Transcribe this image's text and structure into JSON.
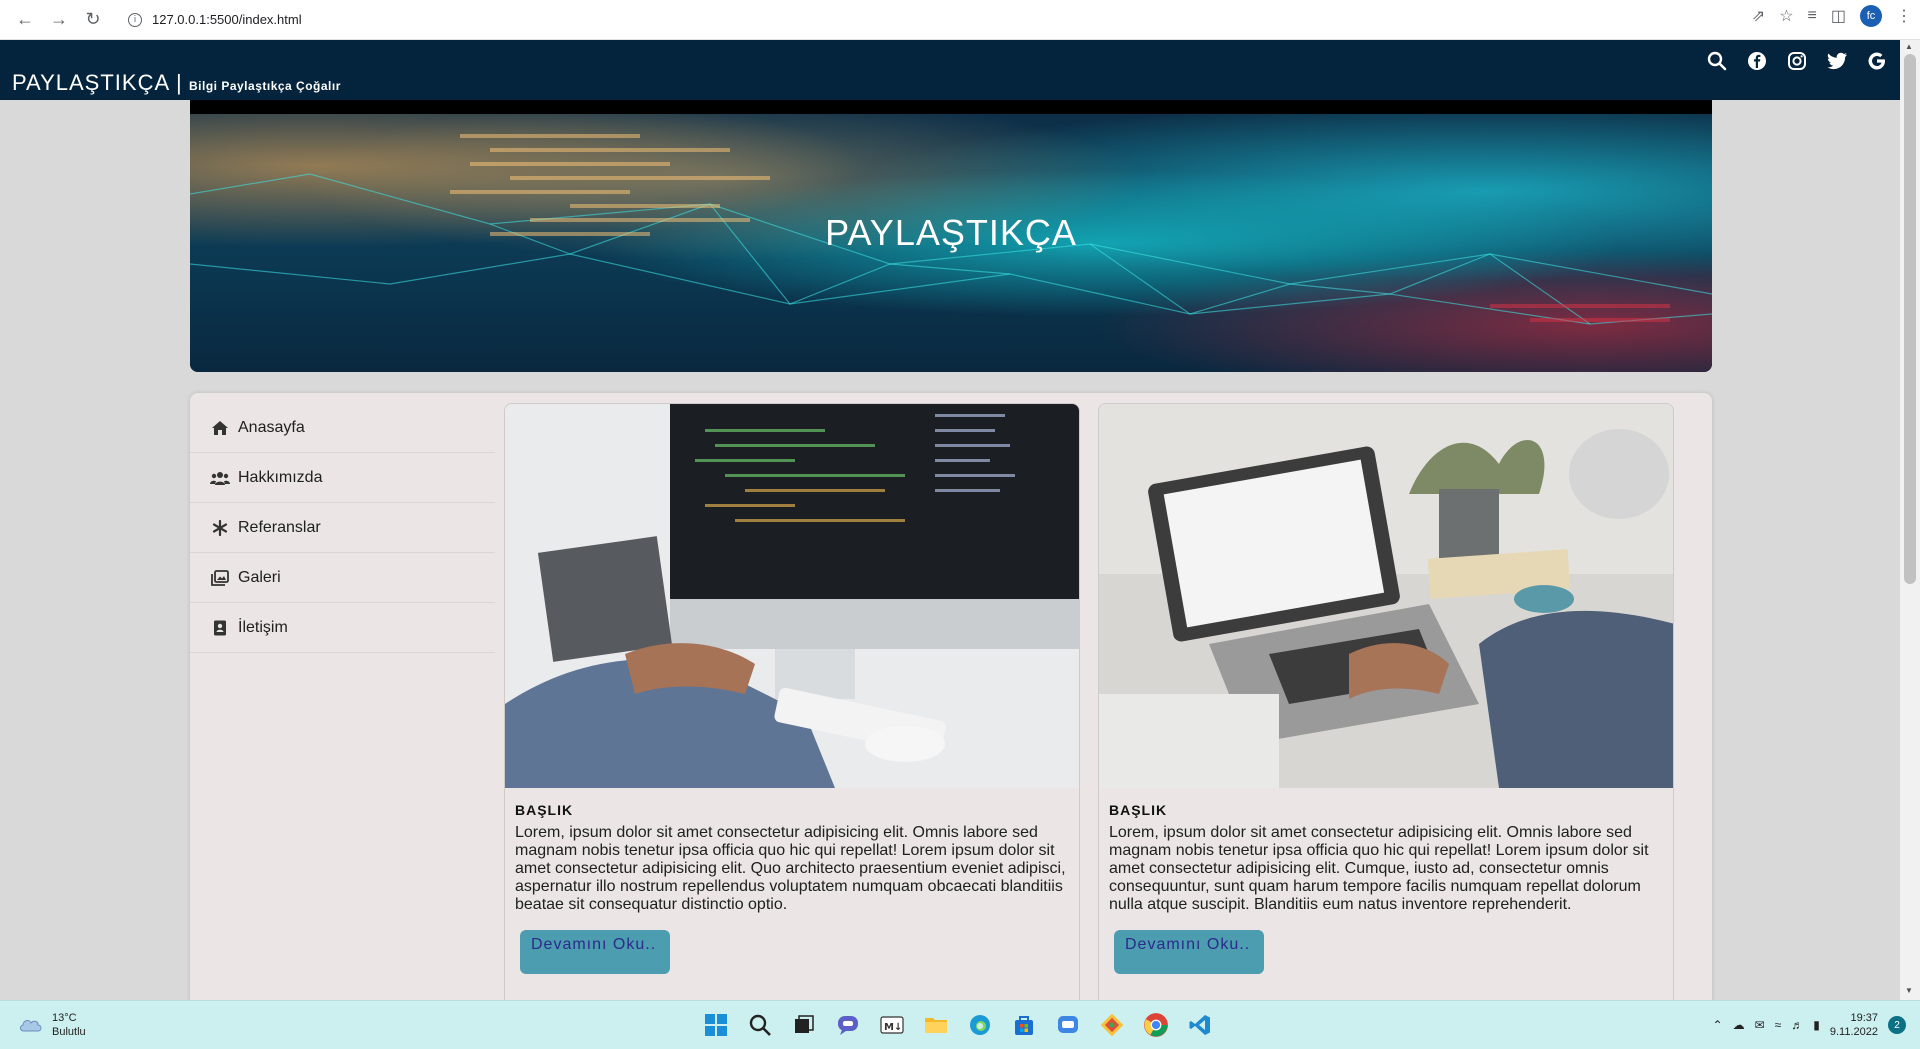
{
  "browser": {
    "url": "127.0.0.1:5500/index.html",
    "profile_initials": "fc"
  },
  "header": {
    "brand": "PAYLAŞTIKÇA |",
    "tagline": "Bilgi Paylaştıkça Çoğalır",
    "social_icons": [
      "search-icon",
      "facebook-icon",
      "instagram-icon",
      "twitter-icon",
      "google-icon"
    ]
  },
  "banner": {
    "title": "PAYLAŞTIKÇA"
  },
  "sidebar": {
    "items": [
      {
        "label": "Anasayfa",
        "icon": "home-icon"
      },
      {
        "label": "Hakkımızda",
        "icon": "users-icon"
      },
      {
        "label": "Referanslar",
        "icon": "asterisk-icon"
      },
      {
        "label": "Galeri",
        "icon": "images-icon"
      },
      {
        "label": "İletişim",
        "icon": "contact-icon"
      }
    ]
  },
  "cards": [
    {
      "title": "BAŞLIK",
      "text": "Lorem, ipsum dolor sit amet consectetur adipisicing elit. Omnis labore sed magnam nobis tenetur ipsa officia quo hic qui repellat! Lorem ipsum dolor sit amet consectetur adipisicing elit. Quo architecto praesentium eveniet adipisci, aspernatur illo nostrum repellendus voluptatem numquam obcaecati blanditiis beatae sit consequatur distinctio optio.",
      "button": "Devamını Oku.."
    },
    {
      "title": "BAŞLIK",
      "text": "Lorem, ipsum dolor sit amet consectetur adipisicing elit. Omnis labore sed magnam nobis tenetur ipsa officia quo hic qui repellat! Lorem ipsum dolor sit amet consectetur adipisicing elit. Cumque, iusto ad, consectetur omnis consequuntur, sunt quam harum tempore facilis numquam repellat dolorum nulla atque suscipit. Blanditiis eum natus inventore reprehenderit.",
      "button": "Devamını Oku.."
    }
  ],
  "taskbar": {
    "temperature": "13°C",
    "weather": "Bulutlu",
    "time": "19:37",
    "date": "9.11.2022",
    "notifications": "2"
  },
  "colors": {
    "header_bg": "#04243d",
    "content_bg": "#ebe5e5",
    "button_bg": "#4d9db1",
    "button_text": "#2b2b8a",
    "taskbar_bg": "#ccf0ef"
  }
}
